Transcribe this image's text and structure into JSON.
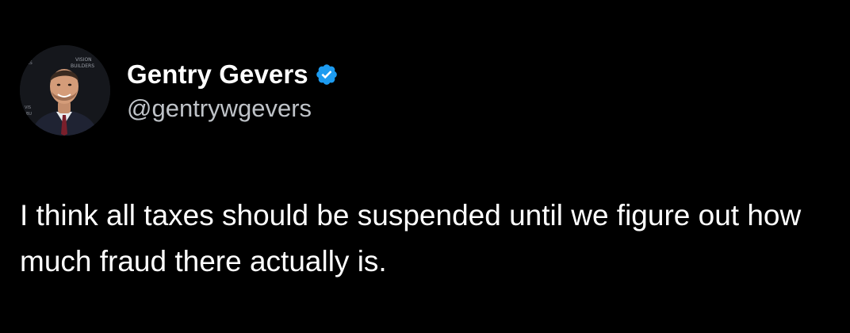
{
  "tweet": {
    "author": {
      "display_name": "Gentry Gevers",
      "handle": "@gentrywgevers",
      "verified": true,
      "avatar_backdrop_text": [
        "VISION",
        "BUILDERS"
      ]
    },
    "text": "I think all taxes should be suspended until we figure out how much fraud there actually is."
  },
  "colors": {
    "background": "#000000",
    "name": "#ffffff",
    "handle": "#bfc3c8",
    "body_text": "#ffffff",
    "verified_badge": "#1d9bf0"
  },
  "icons": {
    "verified": "verified-badge-icon"
  }
}
